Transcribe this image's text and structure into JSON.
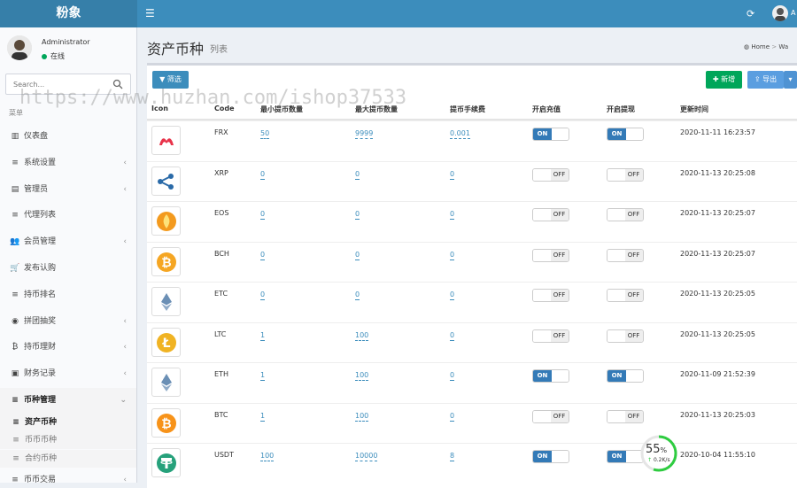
{
  "app": {
    "logo": "粉象",
    "top_user": "A"
  },
  "user": {
    "name": "Administrator",
    "status": "在线"
  },
  "search": {
    "placeholder": "Search..."
  },
  "menu_header": "菜单",
  "nav": [
    {
      "label": "仪表盘",
      "icon": "bar-chart-icon",
      "glyph": "▥",
      "chevron": false
    },
    {
      "label": "系统设置",
      "icon": "sliders-icon",
      "glyph": "≡",
      "chevron": true
    },
    {
      "label": "管理员",
      "icon": "id-card-icon",
      "glyph": "▤",
      "chevron": true
    },
    {
      "label": "代理列表",
      "icon": "list-icon",
      "glyph": "≡",
      "chevron": false
    },
    {
      "label": "会员管理",
      "icon": "users-icon",
      "glyph": "👥",
      "chevron": true
    },
    {
      "label": "发布认购",
      "icon": "cart-icon",
      "glyph": "🛒",
      "chevron": false
    },
    {
      "label": "持币排名",
      "icon": "list-icon",
      "glyph": "≡",
      "chevron": false
    },
    {
      "label": "拼团抽奖",
      "icon": "gamepad-icon",
      "glyph": "◉",
      "chevron": true
    },
    {
      "label": "持币理财",
      "icon": "bitcoin-icon",
      "glyph": "₿",
      "chevron": true
    },
    {
      "label": "财务记录",
      "icon": "money-icon",
      "glyph": "▣",
      "chevron": true
    },
    {
      "label": "币种管理",
      "icon": "list-icon",
      "glyph": "≡",
      "chevron": true
    },
    {
      "label": "币币交易",
      "icon": "list-icon",
      "glyph": "≡",
      "chevron": true
    }
  ],
  "subnav": [
    {
      "label": "资产币种",
      "current": true
    },
    {
      "label": "币币币种",
      "current": false
    },
    {
      "label": "合约币种",
      "current": false
    }
  ],
  "page": {
    "title": "资产币种",
    "subtitle": "列表",
    "breadcrumb_home": "Home",
    "breadcrumb_next": "Wa"
  },
  "toolbar": {
    "filter": "筛选",
    "add": "新增",
    "export": "导出"
  },
  "table": {
    "headers": [
      "Icon",
      "Code",
      "最小提币数量",
      "最大提币数量",
      "提币手续费",
      "开启充值",
      "开启提现",
      "更新时间"
    ],
    "rows": [
      {
        "code": "FRX",
        "min": "50",
        "max": "9999",
        "fee": "0.001",
        "deposit": "ON",
        "withdraw": "ON",
        "updated": "2020-11-11 16:23:57",
        "icon": "frx-logo-icon",
        "color": "#e8334a"
      },
      {
        "code": "XRP",
        "min": "0",
        "max": "0",
        "fee": "0",
        "deposit": "OFF",
        "withdraw": "OFF",
        "updated": "2020-11-13 20:25:08",
        "icon": "xrp-logo-icon",
        "color": "#2a6aa8"
      },
      {
        "code": "EOS",
        "min": "0",
        "max": "0",
        "fee": "0",
        "deposit": "OFF",
        "withdraw": "OFF",
        "updated": "2020-11-13 20:25:07",
        "icon": "eos-logo-icon",
        "color": "#f39a1e"
      },
      {
        "code": "BCH",
        "min": "0",
        "max": "0",
        "fee": "0",
        "deposit": "OFF",
        "withdraw": "OFF",
        "updated": "2020-11-13 20:25:07",
        "icon": "bch-logo-icon",
        "color": "#f5a623"
      },
      {
        "code": "ETC",
        "min": "0",
        "max": "0",
        "fee": "0",
        "deposit": "OFF",
        "withdraw": "OFF",
        "updated": "2020-11-13 20:25:05",
        "icon": "etc-logo-icon",
        "color": "#6b8fb5"
      },
      {
        "code": "LTC",
        "min": "1",
        "max": "100",
        "fee": "0",
        "deposit": "OFF",
        "withdraw": "OFF",
        "updated": "2020-11-13 20:25:05",
        "icon": "ltc-logo-icon",
        "color": "#f0b323"
      },
      {
        "code": "ETH",
        "min": "1",
        "max": "100",
        "fee": "0",
        "deposit": "ON",
        "withdraw": "ON",
        "updated": "2020-11-09 21:52:39",
        "icon": "eth-logo-icon",
        "color": "#6b8fb5"
      },
      {
        "code": "BTC",
        "min": "1",
        "max": "100",
        "fee": "0",
        "deposit": "OFF",
        "withdraw": "OFF",
        "updated": "2020-11-13 20:25:03",
        "icon": "btc-logo-icon",
        "color": "#f7931a"
      },
      {
        "code": "USDT",
        "min": "100",
        "max": "10000",
        "fee": "8",
        "deposit": "ON",
        "withdraw": "ON",
        "updated": "2020-10-04 11:55:10",
        "icon": "usdt-logo-icon",
        "color": "#26a17b"
      }
    ]
  },
  "gauge": {
    "percent": "55",
    "unit": "%",
    "speed": "0.2K/s",
    "value": 0.55,
    "color": "#2ecc40"
  },
  "watermark": "https://www.huzhan.com/ishop37533",
  "colors": {
    "topbar": "#3c8dbc",
    "logo_bg": "#367fa9",
    "switch_on": "#337ab7",
    "add_button": "#00a65a",
    "link": "#3c8dbc"
  }
}
